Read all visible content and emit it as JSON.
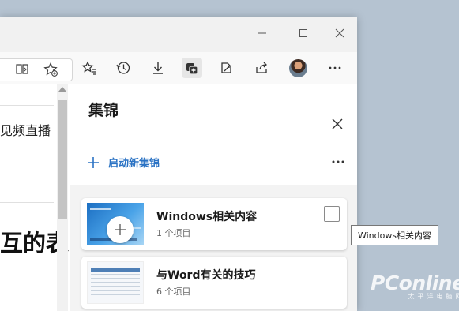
{
  "collections_pane": {
    "title": "集锦",
    "new_collection_label": "启动新集锦",
    "items": [
      {
        "title": "Windows相关内容",
        "count": "1 个项目"
      },
      {
        "title": "与Word有关的技巧",
        "count": "6 个项目"
      }
    ]
  },
  "page": {
    "text_line_1": "见频直播",
    "heading_fragment": "互的表"
  },
  "tooltip": {
    "text": "Windows相关内容"
  },
  "watermark": {
    "brand": "PConline",
    "subtitle": "太平洋电脑网"
  },
  "colors": {
    "accent": "#2b73c4",
    "pane_background": "#f3f3f3",
    "desktop": "#b5c3d1"
  }
}
